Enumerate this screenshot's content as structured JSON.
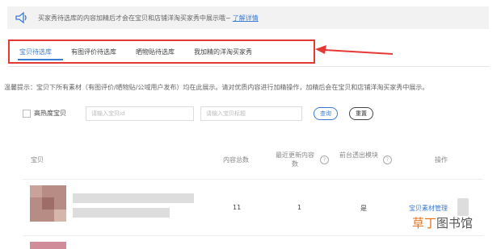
{
  "notice": {
    "text": "买家秀待选库的内容加精后才会在宝贝和店铺洋淘买家秀中展示哦~",
    "link": "了解详情"
  },
  "tabs": [
    "宝贝待选库",
    "有图评价待选库",
    "晒物贴待选库",
    "我加精的洋淘买家秀"
  ],
  "tip": "温馨提示：宝贝下所有素材（有图评价/晒物贴/公域用户发布）均在此展示。请对优质内容进行加精操作，加精后会在宝贝和店铺洋淘买家秀中展示。",
  "filters": {
    "checkbox_label": "高热度宝贝",
    "item_id_placeholder": "请输入宝贝id",
    "item_title_placeholder": "请输入宝贝标题",
    "query_label": "查询",
    "reset_label": "重置"
  },
  "table": {
    "headers": {
      "item": "宝贝",
      "total": "内容总数",
      "updated": "最近更新内容数",
      "frontend": "前台透出模块",
      "action": "操作"
    },
    "rows": [
      {
        "total": "11",
        "updated": "1",
        "frontend": "是",
        "action": "宝贝素材管理"
      }
    ]
  },
  "watermark": {
    "part1": "草丁",
    "part2": "图书馆"
  },
  "colors": {
    "accent": "#3a7bd5",
    "highlight": "#e53935",
    "watermark_orange": "#e8721b"
  }
}
